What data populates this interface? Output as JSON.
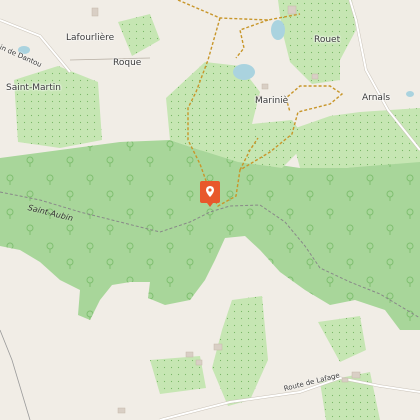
{
  "map": {
    "places": [
      {
        "id": "lafourliere",
        "name": "Lafourlière"
      },
      {
        "id": "roque",
        "name": "Roque"
      },
      {
        "id": "rouet",
        "name": "Rouet"
      },
      {
        "id": "saint-martin",
        "name": "Saint-Martin"
      },
      {
        "id": "marinie",
        "name": "Mariniè"
      },
      {
        "id": "arnals",
        "name": "Arnals"
      }
    ],
    "roads": {
      "chemin_dantou": "in de Dantou",
      "route_lafage": "Route de Lafage"
    },
    "river": {
      "name": "Saint-Aubin"
    },
    "colors": {
      "background": "#f1ede6",
      "forest": "#a8d69a",
      "forest_dark": "#9ccf8d",
      "water": "#aad3df",
      "trail": "#c8962a",
      "marker": "#e8582c"
    },
    "marker_icon": "location-pin-icon"
  }
}
